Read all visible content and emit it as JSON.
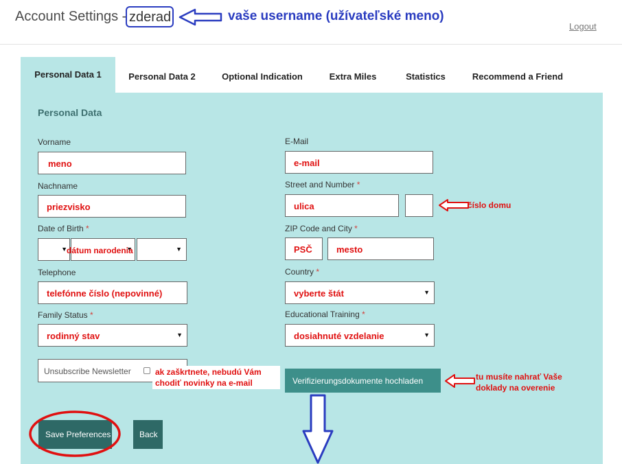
{
  "header": {
    "title": "Account Settings -",
    "username": "zderad",
    "username_note": "vaše username (užívateľské meno)",
    "logout": "Logout"
  },
  "tabs": [
    "Personal Data 1",
    "Personal Data 2",
    "Optional Indication",
    "Extra Miles",
    "Statistics",
    "Recommend a Friend"
  ],
  "section_title": "Personal Data",
  "form": {
    "vorname": {
      "label": "Vorname",
      "value": "meno"
    },
    "nachname": {
      "label": "Nachname",
      "value": "priezvisko"
    },
    "dob": {
      "label": "Date of Birth",
      "required": "*",
      "value": "dátum narodenia"
    },
    "telephone": {
      "label": "Telephone",
      "value": "telefónne číslo (nepovinné)"
    },
    "family_status": {
      "label": "Family Status",
      "required": "*",
      "value": "rodinný stav"
    },
    "email": {
      "label": "E-Mail",
      "value": "e-mail"
    },
    "street": {
      "label": "Street and Number",
      "required": "*",
      "value": "ulica",
      "number_note": "číslo domu"
    },
    "zip_city": {
      "label": "ZIP Code and City",
      "required": "*",
      "zip": "PSČ",
      "city": "mesto"
    },
    "country": {
      "label": "Country",
      "required": "*",
      "value": "vyberte štát"
    },
    "education": {
      "label": "Educational Training",
      "required": "*",
      "value": "dosiahnuté vzdelanie"
    },
    "newsletter": {
      "label": "Unsubscribe Newsletter",
      "note_line1": "ak zaškrtnete, nebudú Vám",
      "note_line2": "chodiť novinky na e-mail"
    }
  },
  "buttons": {
    "verify": "Verifizierungsdokumente hochladen",
    "verify_note_line1": "tu musíte nahrať Vaše",
    "verify_note_line2": "doklady na overenie",
    "save": "Save Preferences",
    "back": "Back"
  },
  "colors": {
    "panel": "#b8e6e6",
    "button": "#2e6966",
    "annotation_red": "#e01010",
    "annotation_blue": "#2a3cc0"
  }
}
